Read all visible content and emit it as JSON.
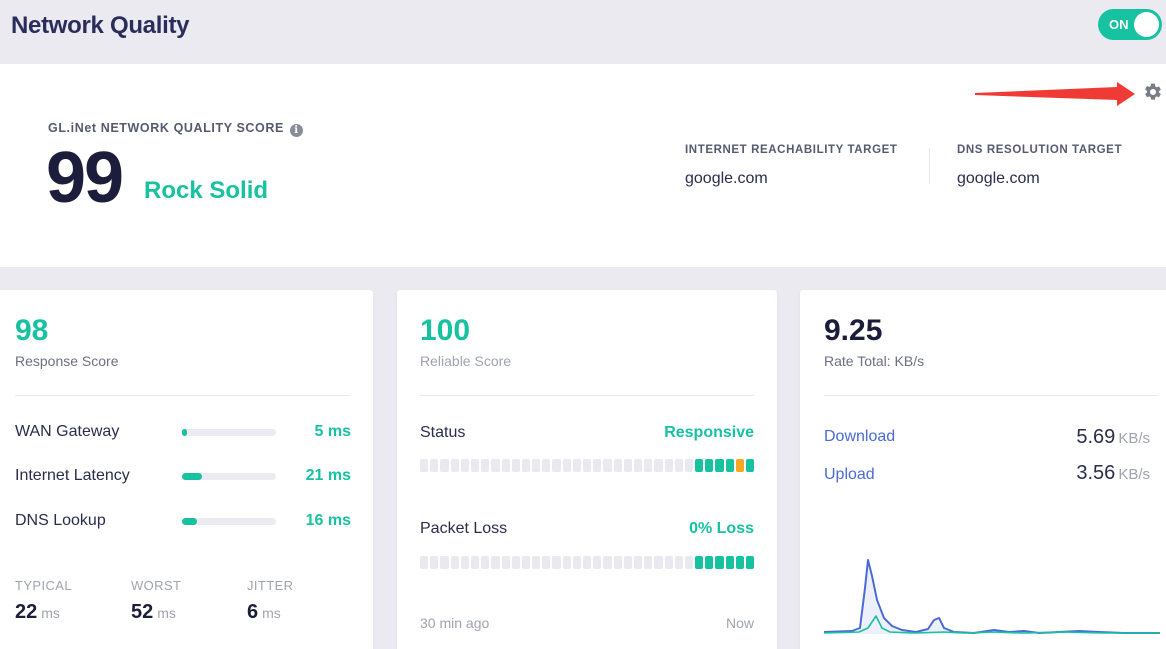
{
  "header": {
    "title": "Network Quality",
    "toggle_label": "ON"
  },
  "score": {
    "label": "GL.iNet NETWORK QUALITY SCORE",
    "value": "99",
    "verdict": "Rock Solid",
    "targets": [
      {
        "label": "INTERNET REACHABILITY TARGET",
        "value": "google.com"
      },
      {
        "label": "DNS RESOLUTION TARGET",
        "value": "google.com"
      }
    ]
  },
  "response": {
    "score": "98",
    "label": "Response Score",
    "metrics": [
      {
        "name": "WAN Gateway",
        "value": "5 ms",
        "level": 0.05
      },
      {
        "name": "Internet Latency",
        "value": "21 ms",
        "level": 0.21
      },
      {
        "name": "DNS Lookup",
        "value": "16 ms",
        "level": 0.16
      }
    ],
    "stats": [
      {
        "label": "TYPICAL",
        "value": "22",
        "unit": "ms"
      },
      {
        "label": "WORST",
        "value": "52",
        "unit": "ms"
      },
      {
        "label": "JITTER",
        "value": "6",
        "unit": "ms"
      }
    ]
  },
  "reliable": {
    "score": "100",
    "label": "Reliable Score",
    "status_label": "Status",
    "status_value": "Responsive",
    "status_segments": [
      "empty",
      "empty",
      "empty",
      "empty",
      "empty",
      "empty",
      "empty",
      "empty",
      "empty",
      "empty",
      "empty",
      "empty",
      "empty",
      "empty",
      "empty",
      "empty",
      "empty",
      "empty",
      "empty",
      "empty",
      "empty",
      "empty",
      "empty",
      "empty",
      "empty",
      "empty",
      "empty",
      "ok",
      "ok",
      "ok",
      "ok",
      "warn",
      "ok"
    ],
    "loss_label": "Packet Loss",
    "loss_value": "0% Loss",
    "loss_segments": [
      "empty",
      "empty",
      "empty",
      "empty",
      "empty",
      "empty",
      "empty",
      "empty",
      "empty",
      "empty",
      "empty",
      "empty",
      "empty",
      "empty",
      "empty",
      "empty",
      "empty",
      "empty",
      "empty",
      "empty",
      "empty",
      "empty",
      "empty",
      "empty",
      "empty",
      "empty",
      "empty",
      "ok",
      "ok",
      "ok",
      "ok",
      "ok",
      "ok"
    ],
    "time_start": "30 min ago",
    "time_end": "Now"
  },
  "rate": {
    "total": "9.25",
    "label": "Rate Total: KB/s",
    "download_label": "Download",
    "download_value": "5.69",
    "download_unit": "KB/s",
    "upload_label": "Upload",
    "upload_value": "3.56",
    "upload_unit": "KB/s",
    "colors": {
      "download": "#4a6ad8",
      "upload": "#16c2a0"
    }
  }
}
